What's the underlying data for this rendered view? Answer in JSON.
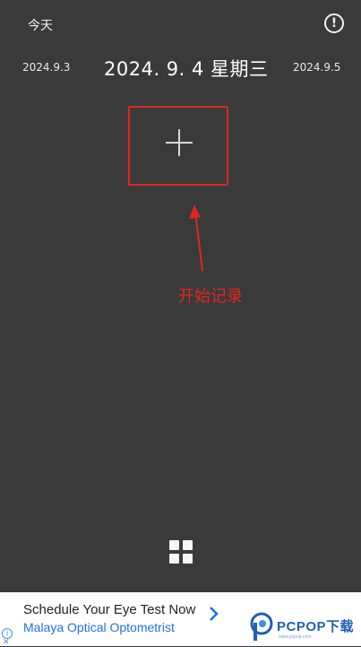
{
  "header": {
    "today_label": "今天",
    "info_icon": "exclamation-circle-icon",
    "info_glyph": "!"
  },
  "dates": {
    "prev": "2024.9.3",
    "current": "2024. 9. 4 星期三",
    "next": "2024.9.5"
  },
  "main": {
    "add_icon": "plus-icon",
    "annotation": "开始记录",
    "annotation_color": "#e0261f"
  },
  "bottom": {
    "grid_icon": "grid-icon"
  },
  "ad": {
    "title": "Schedule Your Eye Test Now",
    "subtitle": "Malaya Optical Optometrist",
    "info_glyph": "i",
    "close_glyph": "✕"
  },
  "watermark": {
    "text": "PCPOP下载",
    "small": "www.pcpop.com"
  },
  "colors": {
    "background": "#3a3a3a",
    "accent_red": "#e0261f",
    "ad_link": "#1a73e8"
  }
}
